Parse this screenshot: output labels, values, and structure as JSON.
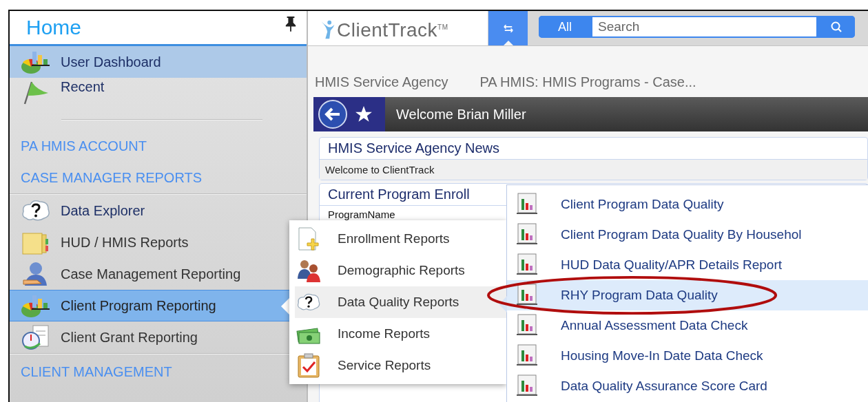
{
  "sidebar": {
    "title": "Home",
    "groups": [
      {
        "kind": "nav",
        "items": [
          {
            "label": "User Dashboard",
            "selected": true,
            "expanded": false
          },
          {
            "label": "Recent",
            "selected": false,
            "expanded": false
          }
        ]
      },
      {
        "kind": "section",
        "items": [
          {
            "label": "PA HMIS ACCOUNT"
          },
          {
            "label": "CASE MANAGER REPORTS"
          }
        ]
      },
      {
        "kind": "nav",
        "items": [
          {
            "label": "Data Explorer",
            "selected": false,
            "expanded": false
          },
          {
            "label": "HUD / HMIS Reports",
            "selected": false,
            "expanded": false
          },
          {
            "label": "Case Management Reporting",
            "selected": false,
            "expanded": false
          },
          {
            "label": "Client Program Reporting",
            "selected": false,
            "expanded": true
          },
          {
            "label": "Client Grant Reporting",
            "selected": false,
            "expanded": false
          }
        ]
      },
      {
        "kind": "section",
        "items": [
          {
            "label": "CLIENT MANAGEMENT"
          }
        ]
      }
    ]
  },
  "top_bar": {
    "logo": "ClientTrack$^{TM}$",
    "search": {
      "scope": "All",
      "placeholder": "Search"
    }
  },
  "breadcrumb": [
    "HMIS Service Agency",
    "PA HMIS: HMIS Programs - Case..."
  ],
  "welcome": "Welcome Brian Miller",
  "news_panel": {
    "title": "HMIS Service Agency News",
    "body": "Welcome to ClientTrack"
  },
  "enrollment_panel": {
    "title": "Current Program Enroll",
    "column": "ProgramName"
  },
  "category_menu": [
    {
      "label": "Enrollment Reports",
      "selected": false
    },
    {
      "label": "Demographic Reports",
      "selected": false
    },
    {
      "label": "Data Quality Reports",
      "selected": true
    },
    {
      "label": "Income Reports",
      "selected": false
    },
    {
      "label": "Service Reports",
      "selected": false
    }
  ],
  "report_menu": [
    {
      "label": "Client Program Data Quality",
      "selected": false,
      "circled": false
    },
    {
      "label": "Client Program Data Quality By Househol",
      "selected": false,
      "circled": false
    },
    {
      "label": "HUD Data Quality/APR Details Report",
      "selected": false,
      "circled": false
    },
    {
      "label": "RHY Program Data Quality",
      "selected": true,
      "circled": true
    },
    {
      "label": "Annual Assessment Data Check",
      "selected": false,
      "circled": false
    },
    {
      "label": "Housing Move-In Date Data Check",
      "selected": false,
      "circled": false
    },
    {
      "label": "Data Quality Assurance Score Card",
      "selected": false,
      "circled": false
    }
  ]
}
